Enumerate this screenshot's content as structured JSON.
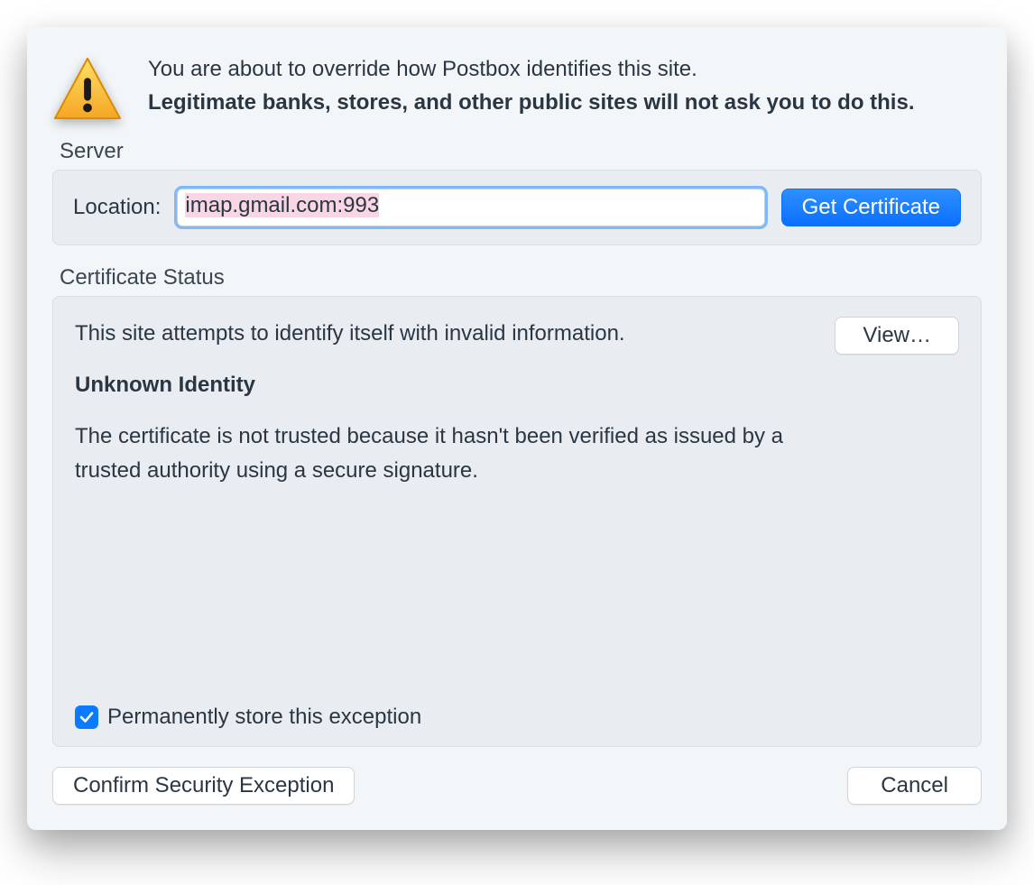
{
  "header": {
    "line1": "You are about to override how Postbox identifies this site.",
    "line2": "Legitimate banks, stores, and other public sites will not ask you to do this."
  },
  "server": {
    "section_label": "Server",
    "location_label": "Location:",
    "location_value": "imap.gmail.com:993",
    "get_cert_label": "Get Certificate"
  },
  "certificate": {
    "section_label": "Certificate Status",
    "invalid_info": "This site attempts to identify itself with invalid information.",
    "view_label": "View…",
    "identity_title": "Unknown Identity",
    "identity_detail": "The certificate is not trusted because it hasn't been verified as issued by a trusted authority using a secure signature.",
    "store_checkbox_label": "Permanently store this exception",
    "store_checked": true
  },
  "footer": {
    "confirm_label": "Confirm Security Exception",
    "cancel_label": "Cancel"
  }
}
